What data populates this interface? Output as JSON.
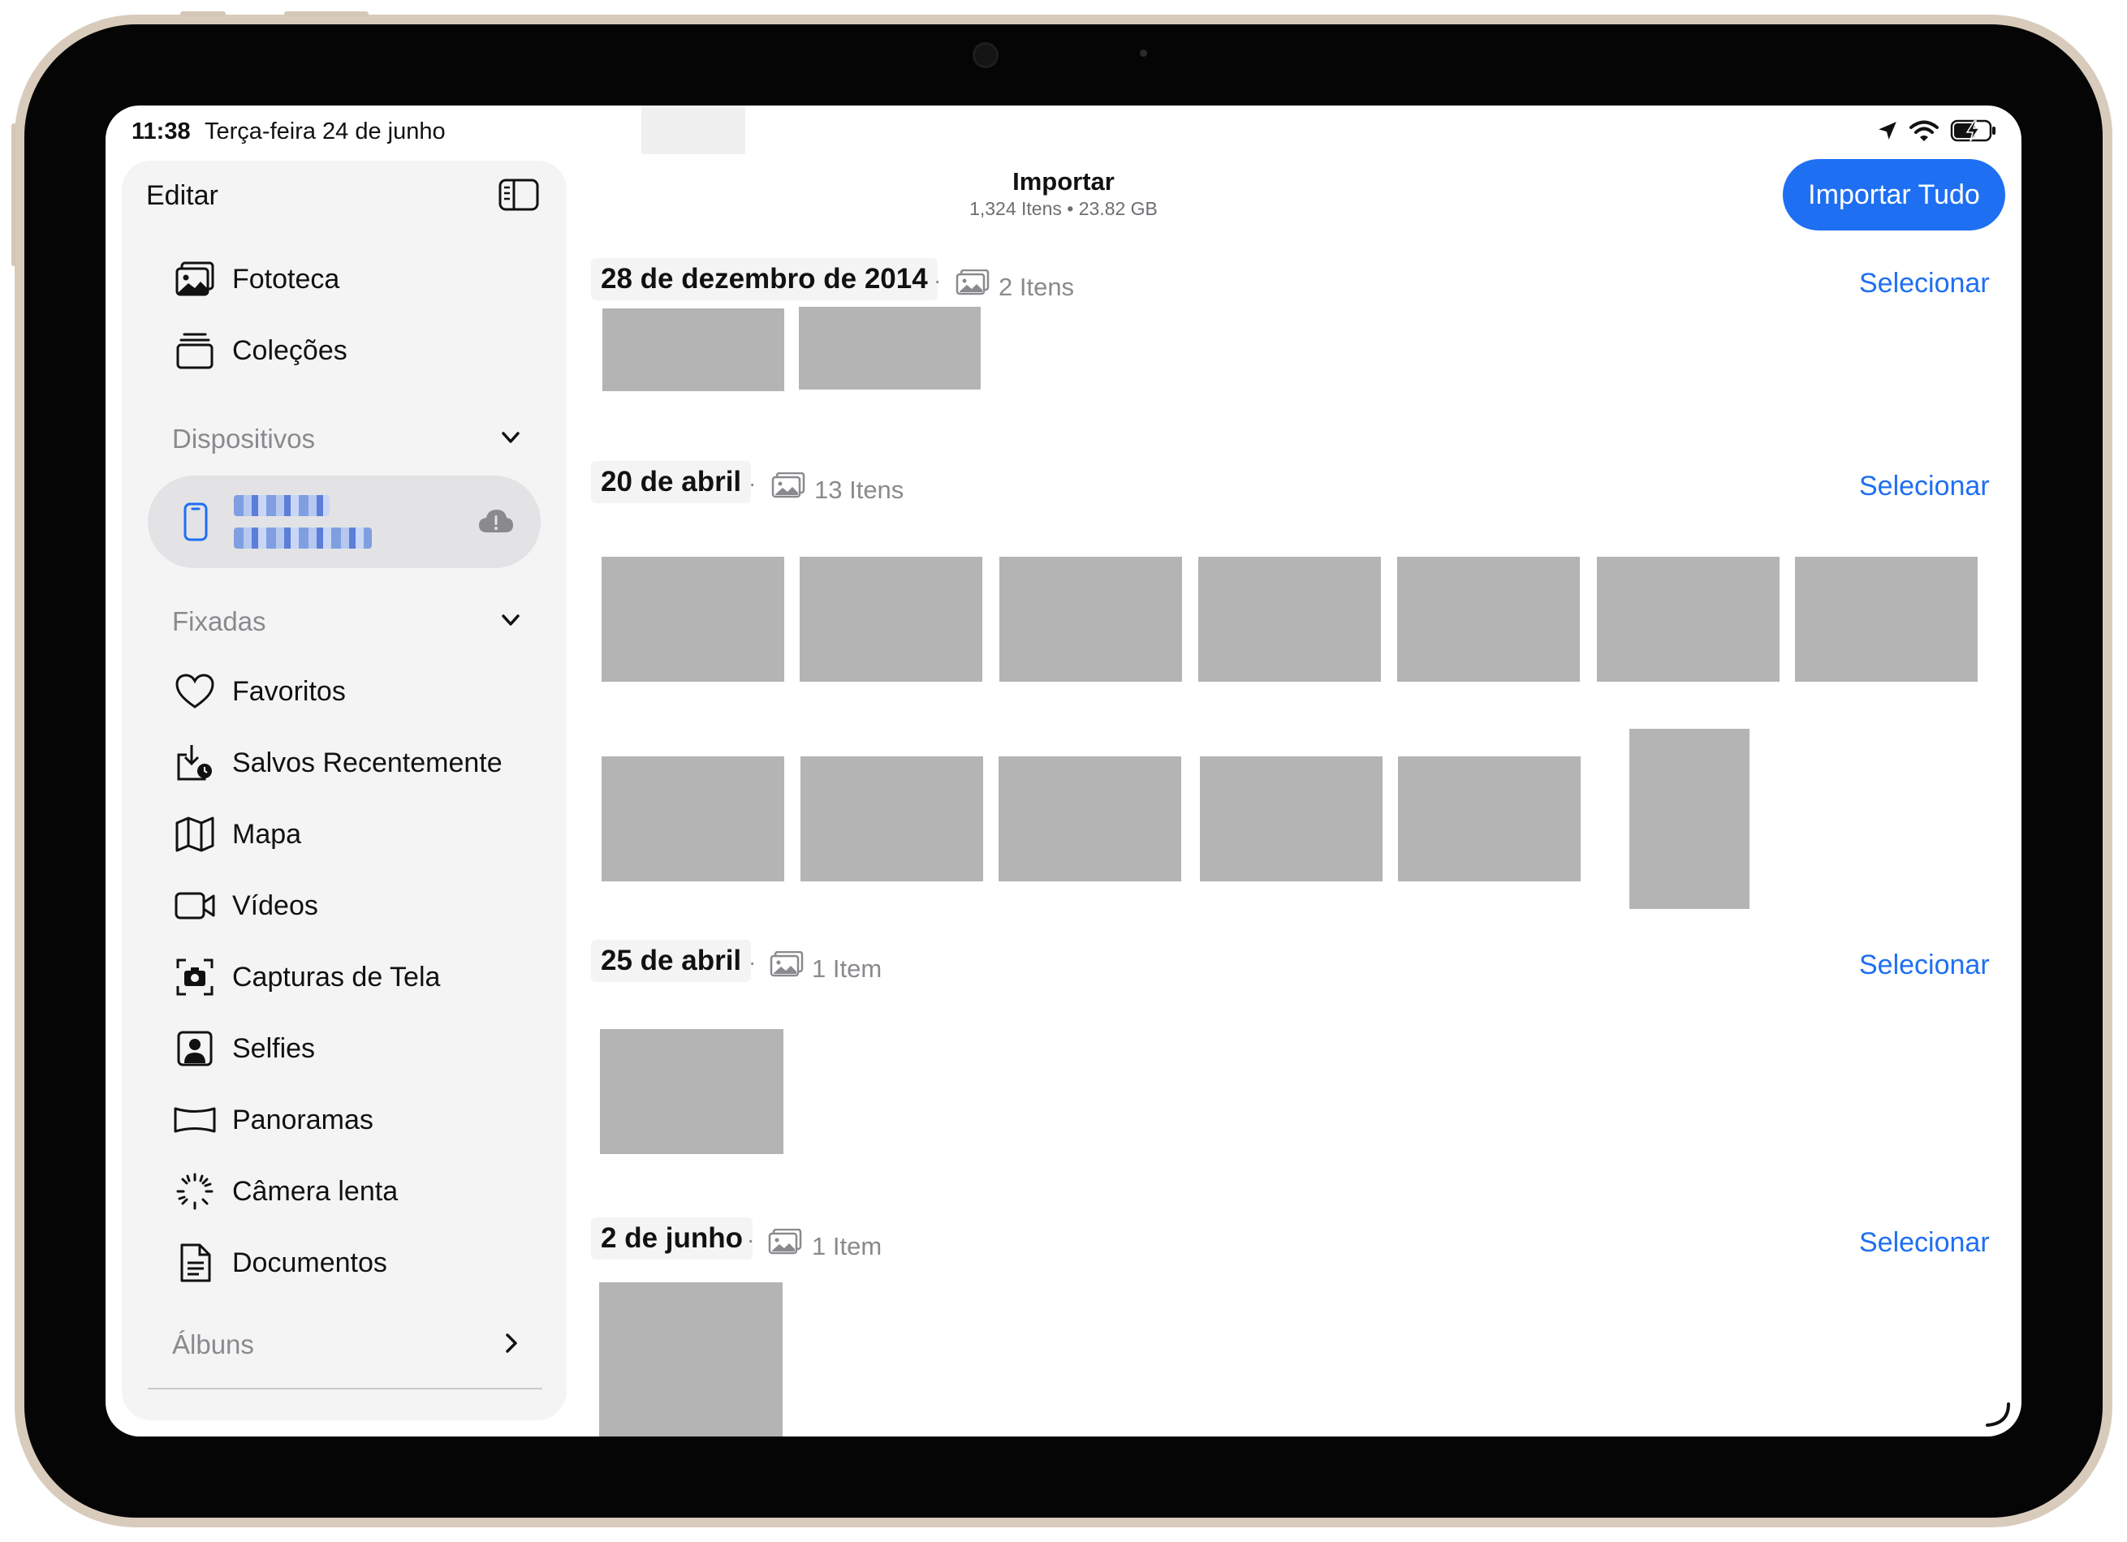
{
  "status_bar": {
    "time": "11:38",
    "date": "Terça-feira 24 de junho"
  },
  "sidebar": {
    "edit_label": "Editar",
    "top_items": [
      {
        "label": "Fototeca",
        "icon": "photo-library-icon"
      },
      {
        "label": "Coleções",
        "icon": "collections-icon"
      }
    ],
    "devices_header": "Dispositivos",
    "pinned_header": "Fixadas",
    "pinned_items": [
      {
        "label": "Favoritos",
        "icon": "heart-icon"
      },
      {
        "label": "Salvos Recentemente",
        "icon": "recently-saved-icon"
      },
      {
        "label": "Mapa",
        "icon": "map-icon"
      },
      {
        "label": "Vídeos",
        "icon": "video-icon"
      },
      {
        "label": "Capturas de Tela",
        "icon": "screenshot-icon"
      },
      {
        "label": "Selfies",
        "icon": "selfie-icon"
      },
      {
        "label": "Panoramas",
        "icon": "panorama-icon"
      },
      {
        "label": "Câmera lenta",
        "icon": "slow-motion-icon"
      },
      {
        "label": "Documentos",
        "icon": "document-icon"
      }
    ],
    "albums_header": "Álbuns"
  },
  "header": {
    "title": "Importar",
    "subtitle": "1,324 Itens • 23.82 GB",
    "import_all_label": "Importar Tudo"
  },
  "groups": [
    {
      "date": "28 de dezembro de 2014",
      "count": "2 Itens",
      "select_label": "Selecionar"
    },
    {
      "date": "20 de abril",
      "count": "13 Itens",
      "select_label": "Selecionar"
    },
    {
      "date": "25 de abril",
      "count": "1 Item",
      "select_label": "Selecionar"
    },
    {
      "date": "2 de junho",
      "count": "1 Item",
      "select_label": "Selecionar"
    }
  ],
  "colors": {
    "accent": "#1e6ff2",
    "thumbnail_placeholder": "#b4b4b4",
    "sidebar_bg": "#f4f4f5"
  }
}
